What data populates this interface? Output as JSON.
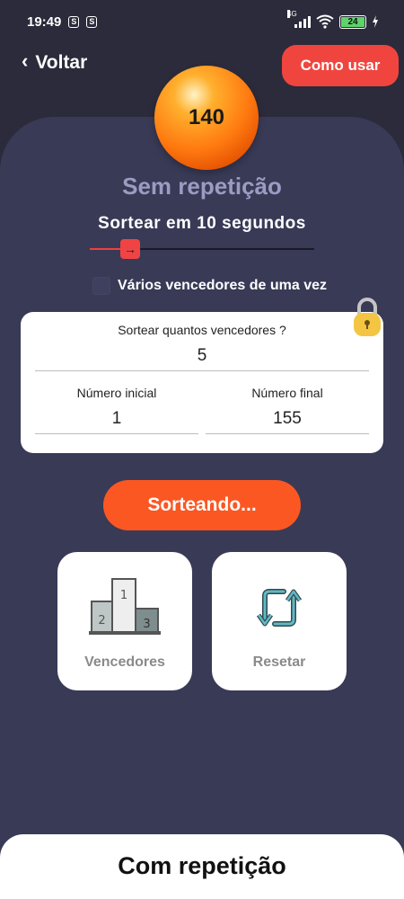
{
  "status_bar": {
    "time": "19:49",
    "net_type": "4G",
    "battery": "24",
    "mini_icons": [
      "S",
      "S"
    ],
    "icons": [
      "signal-icon",
      "wifi-icon",
      "battery-icon",
      "charging-icon"
    ]
  },
  "header": {
    "back_label": "Voltar",
    "help_label": "Como usar"
  },
  "ball": {
    "number": "140"
  },
  "mode": {
    "title": "Sem repetição",
    "countdown": "Sortear em 10 segundos",
    "slider_fraction": 0.18,
    "multi_winners_label": "Vários vencedores de uma vez"
  },
  "config": {
    "question": "Sortear quantos vencedores ?",
    "count": "5",
    "start_label": "Número inicial",
    "start_value": "1",
    "end_label": "Número final",
    "end_value": "155"
  },
  "draw_button": {
    "label": "Sorteando..."
  },
  "tiles": {
    "winners_label": "Vencedores",
    "reset_label": "Resetar",
    "podium_numbers": [
      "1",
      "2",
      "3"
    ]
  },
  "bottom_sheet": {
    "title": "Com repetição"
  },
  "colors": {
    "accent_red": "#f0453f",
    "accent_orange": "#fb5723",
    "card_bg": "#393a56",
    "page_bg": "#2b2b3b"
  }
}
